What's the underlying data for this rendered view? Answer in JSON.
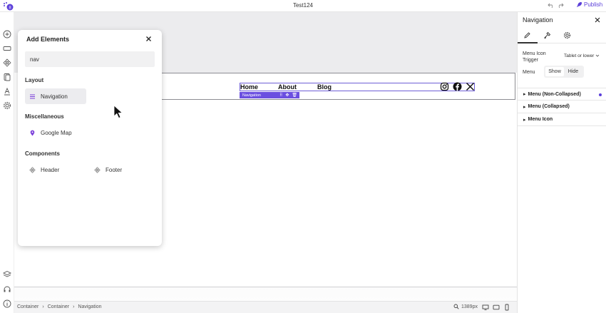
{
  "app": {
    "title": "Test124",
    "publish_label": "Publish"
  },
  "add_panel": {
    "title": "Add Elements",
    "search_value": "nav",
    "sections": {
      "layout": "Layout",
      "misc": "Miscellaneous",
      "components": "Components"
    },
    "items": {
      "navigation": "Navigation",
      "google_map": "Google Map",
      "header": "Header",
      "footer": "Footer"
    }
  },
  "canvas": {
    "nav_links": [
      "Home",
      "About",
      "Blog"
    ],
    "selection_tag": "Navigation"
  },
  "right_panel": {
    "title": "Navigation",
    "menu_icon_trigger_label": "Menu Icon Trigger",
    "menu_icon_trigger_value": "Tablet or lower",
    "menu_label": "Menu",
    "show_label": "Show",
    "hide_label": "Hide",
    "accordions": [
      "Menu (Non-Collapsed)",
      "Menu (Collapsed)",
      "Menu Icon"
    ]
  },
  "status_bar": {
    "breadcrumb": [
      "Container",
      "Container",
      "Navigation"
    ],
    "zoom": "1389px"
  },
  "colors": {
    "accent": "#5b3fd9",
    "tag": "#6b4fe0"
  }
}
